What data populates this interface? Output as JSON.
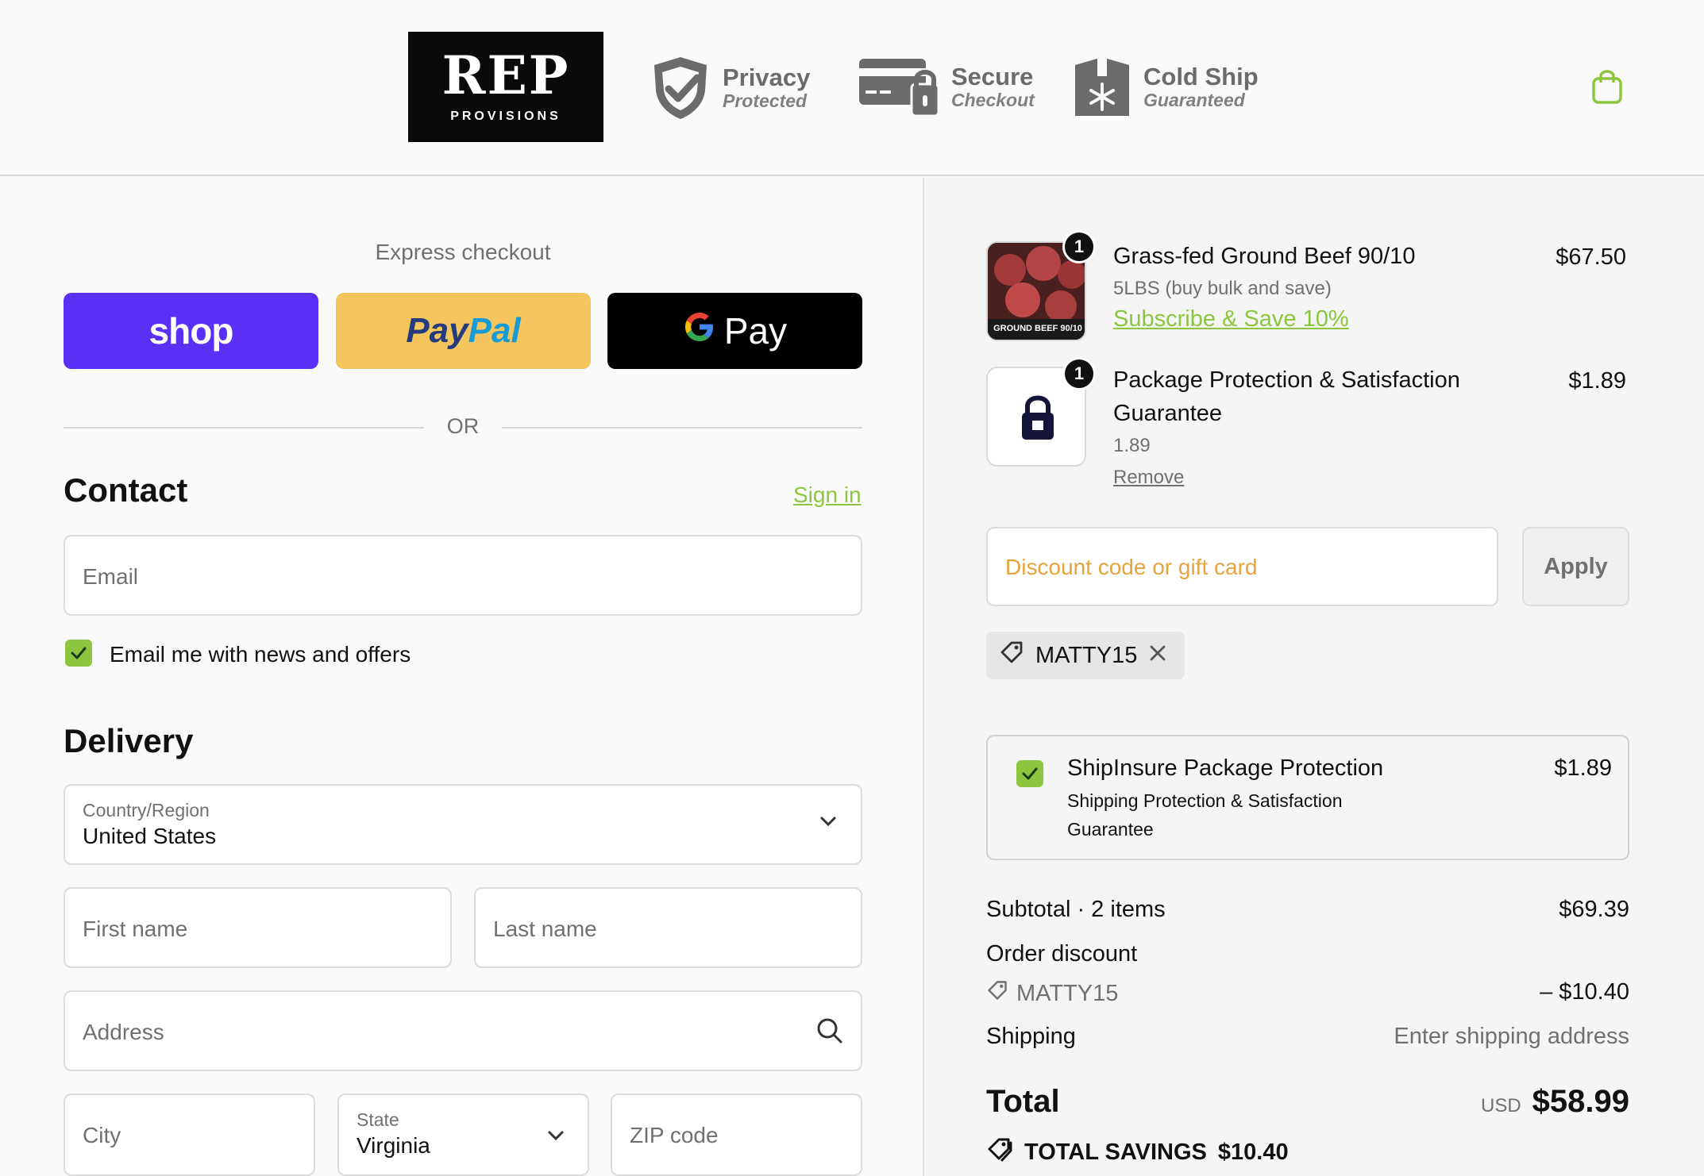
{
  "header": {
    "logo_main": "REP",
    "logo_sub": "PROVISIONS",
    "badges": [
      {
        "title": "Privacy",
        "subtitle": "Protected",
        "icon": "shield-check-icon"
      },
      {
        "title": "Secure",
        "subtitle": "Checkout",
        "icon": "card-lock-icon"
      },
      {
        "title": "Cold Ship",
        "subtitle": "Guaranteed",
        "icon": "snowflake-box-icon"
      }
    ],
    "cart_icon": "shopping-bag-icon"
  },
  "express": {
    "title": "Express checkout",
    "shop_label": "shop",
    "paypal_label_1": "Pay",
    "paypal_label_2": "Pal",
    "gpay_label": "Pay",
    "or_text": "OR"
  },
  "contact": {
    "heading": "Contact",
    "signin": "Sign in",
    "email_placeholder": "Email",
    "newsletter_label": "Email me with news and offers",
    "newsletter_checked": true
  },
  "delivery": {
    "heading": "Delivery",
    "country_label": "Country/Region",
    "country_value": "United States",
    "first_name_placeholder": "First name",
    "last_name_placeholder": "Last name",
    "address_placeholder": "Address",
    "city_placeholder": "City",
    "state_label": "State",
    "state_value": "Virginia",
    "zip_placeholder": "ZIP code"
  },
  "cart": {
    "items": [
      {
        "name": "Grass-fed Ground Beef 90/10",
        "variant": "5LBS (buy bulk and save)",
        "price": "$67.50",
        "qty": "1",
        "subscribe": "Subscribe & Save 10%",
        "image_text": "GROUND BEEF 90/10"
      },
      {
        "name_line1": "Package Protection & Satisfaction",
        "name_line2": "Guarantee",
        "variant": "1.89",
        "price": "$1.89",
        "qty": "1",
        "remove": "Remove"
      }
    ],
    "discount_placeholder": "Discount code or gift card",
    "apply_label": "Apply",
    "applied_code": "MATTY15"
  },
  "insurance": {
    "title": "ShipInsure Package Protection",
    "desc_line1": "Shipping Protection & Satisfaction",
    "desc_line2": "Guarantee",
    "price": "$1.89",
    "checked": true
  },
  "summary": {
    "subtotal_label": "Subtotal · 2 items",
    "subtotal_value": "$69.39",
    "discount_label": "Order discount",
    "discount_code": "MATTY15",
    "discount_value": "– $10.40",
    "shipping_label": "Shipping",
    "shipping_value": "Enter shipping address",
    "total_label": "Total",
    "currency": "USD",
    "total_value": "$58.99",
    "savings_label": "TOTAL SAVINGS",
    "savings_value": "$10.40"
  },
  "colors": {
    "accent_green": "#8cc63f",
    "shop_purple": "#5a31f4",
    "paypal_yellow": "#f4c55c",
    "discount_placeholder_orange": "#e8a33d"
  }
}
